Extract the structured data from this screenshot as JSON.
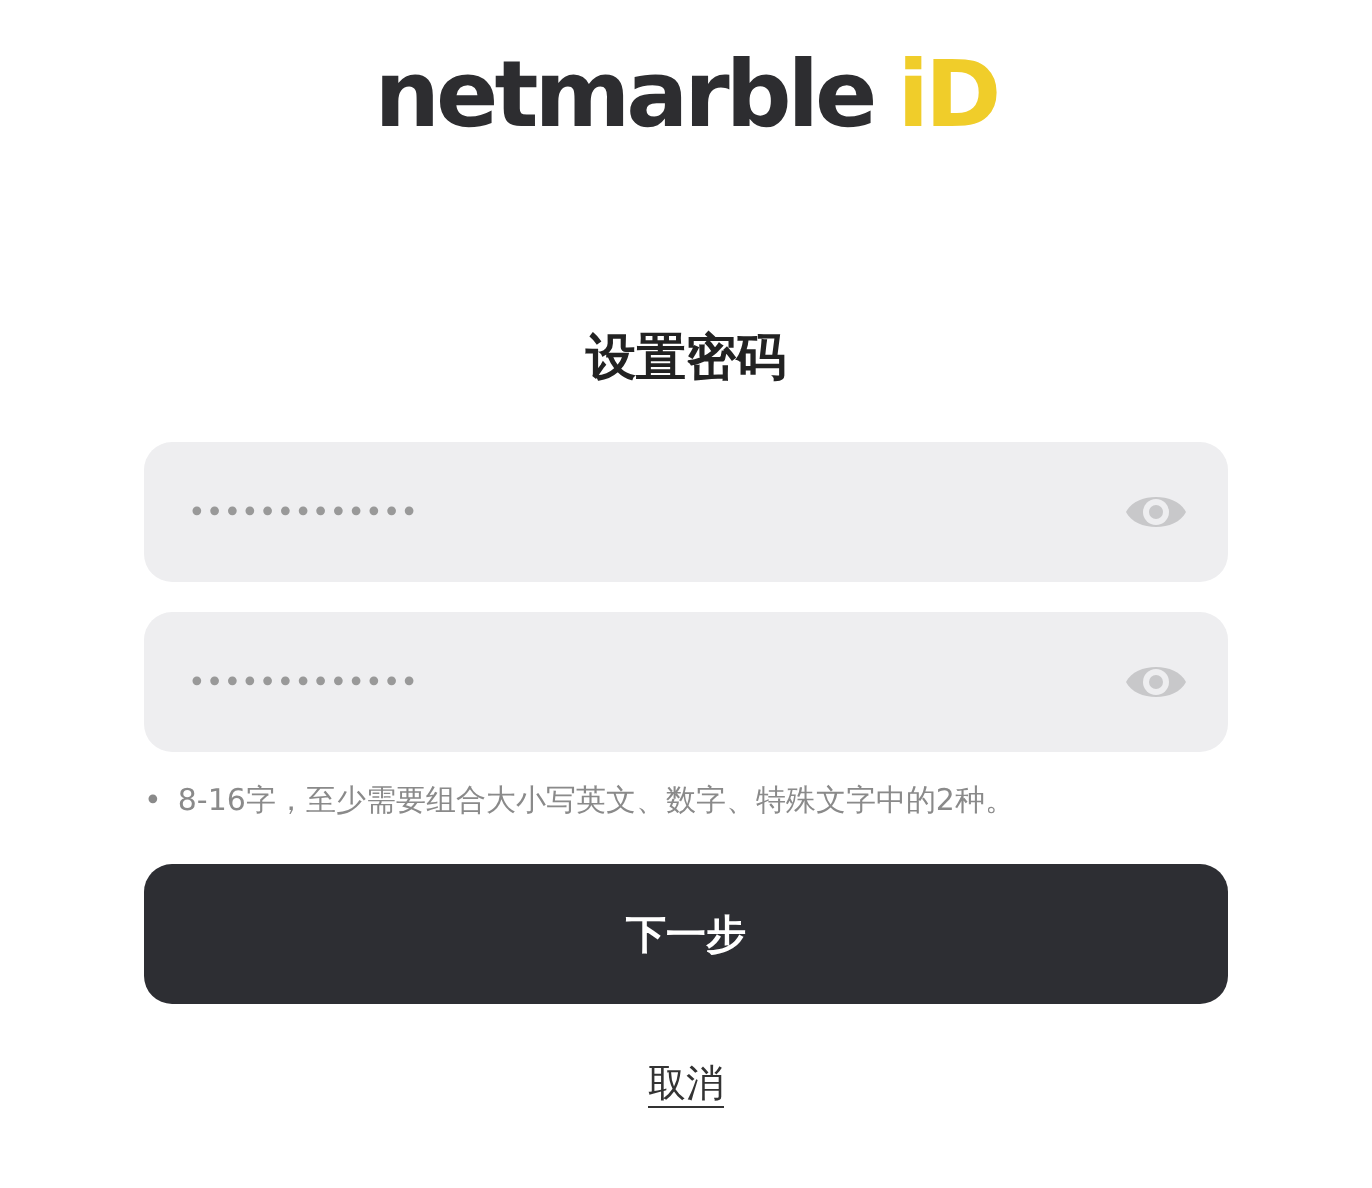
{
  "logo": {
    "brand": "netmarble",
    "suffix": "iD"
  },
  "title": "设置密码",
  "fields": [
    {
      "value": "•••••••••••••"
    },
    {
      "value": "•••••••••••••"
    }
  ],
  "hint": {
    "bullet": "•",
    "text": "8-16字，至少需要组合大小写英文、数字、特殊文字中的2种。"
  },
  "next_button": "下一步",
  "cancel_link": "取消"
}
